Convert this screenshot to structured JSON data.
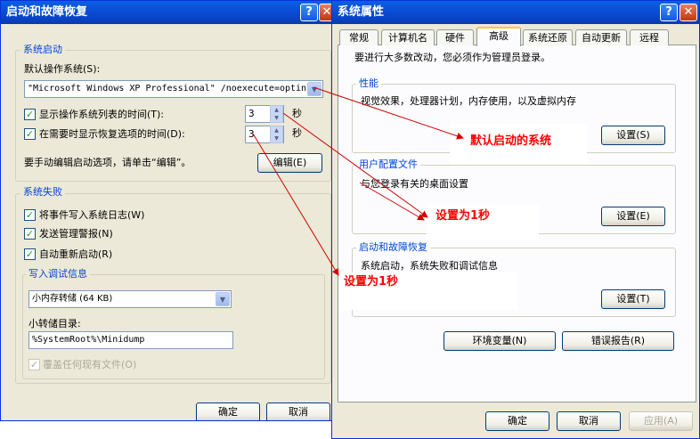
{
  "startup_dialog": {
    "title": "启动和故障恢复",
    "help_label": "?",
    "close_label": "✕",
    "system_startup": {
      "group_label": "系统启动",
      "default_os_label": "默认操作系统(S):",
      "default_os_value": "\"Microsoft Windows XP Professional\" /noexecute=optin",
      "show_list_label": "显示操作系统列表的时间(T):",
      "show_list_checked": true,
      "show_list_value": "3",
      "recovery_label": "在需要时显示恢复选项的时间(D):",
      "recovery_checked": true,
      "recovery_value": "3",
      "seconds_unit": "秒",
      "edit_hint": "要手动编辑启动选项，请单击“编辑”。",
      "edit_button": "编辑(E)"
    },
    "system_failure": {
      "group_label": "系统失败",
      "write_log_label": "将事件写入系统日志(W)",
      "write_log_checked": true,
      "send_alert_label": "发送管理警报(N)",
      "send_alert_checked": true,
      "auto_restart_label": "自动重新启动(R)",
      "auto_restart_checked": true
    },
    "debug_info": {
      "group_label": "写入调试信息",
      "dump_type_value": "小内存转储 (64 KB)",
      "dump_dir_label": "小转储目录:",
      "dump_dir_value": "%SystemRoot%\\Minidump",
      "overwrite_label": "覆盖任何现有文件(O)",
      "overwrite_checked": true
    },
    "ok_button": "确定",
    "cancel_button": "取消"
  },
  "system_properties": {
    "title": "系统属性",
    "help_label": "?",
    "close_label": "✕",
    "tabs": [
      "常规",
      "计算机名",
      "硬件",
      "高级",
      "系统还原",
      "自动更新",
      "远程"
    ],
    "active_tab": "高级",
    "admin_note": "要进行大多数改动，您必须作为管理员登录。",
    "performance": {
      "group_label": "性能",
      "description": "视觉效果，处理器计划，内存使用，以及虚拟内存",
      "settings_button": "设置(S)"
    },
    "user_profiles": {
      "group_label": "用户配置文件",
      "description": "与您登录有关的桌面设置",
      "settings_button": "设置(E)"
    },
    "startup_recovery": {
      "group_label": "启动和故障恢复",
      "description": "系统启动，系统失败和调试信息",
      "settings_button": "设置(T)"
    },
    "env_vars_button": "环境变量(N)",
    "error_report_button": "错误报告(R)",
    "ok_button": "确定",
    "cancel_button": "取消",
    "apply_button": "应用(A)"
  },
  "annotations": {
    "default_os": "默认启动的系统",
    "set_one_second_a": "设置为1秒",
    "set_one_second_b": "设置为1秒"
  },
  "colors": {
    "titlebar": "#0842c4",
    "dialog_bg": "#ece9d8",
    "group_label": "#0046d5",
    "annotation": "#ff0000",
    "active_tab_accent": "#ffc83c"
  }
}
